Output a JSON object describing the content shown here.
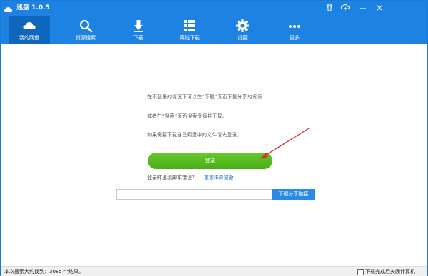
{
  "app": {
    "title": "迷盘 1.0.5",
    "accent_color": "#1d82e2",
    "logo_icon": "cloud-logo-icon"
  },
  "window_controls": [
    {
      "name": "skin-icon"
    },
    {
      "name": "upload-icon"
    },
    {
      "name": "minimize-icon"
    },
    {
      "name": "close-icon"
    }
  ],
  "toolbar": {
    "tabs": [
      {
        "label": "我的网盘",
        "icon": "cloud-icon",
        "active": true
      },
      {
        "label": "资源搜索",
        "icon": "search-icon",
        "active": false
      },
      {
        "label": "下载",
        "icon": "download-icon",
        "active": false
      },
      {
        "label": "离线下载",
        "icon": "list-icon",
        "active": false
      },
      {
        "label": "设置",
        "icon": "gear-icon",
        "active": false
      },
      {
        "label": "更多",
        "icon": "more-icon",
        "active": false
      }
    ]
  },
  "main": {
    "line1": "在不登录的情况下可以在“下载”页面下载分享的资源",
    "line2": "或者在“搜索”页面搜索资源并下载。",
    "line3": "如果需要下载自己网盘中的文件请先登录。",
    "login_button": "登录",
    "login_error_text": "登录时出现脚本错误？",
    "reset_browser_link": "重置IE浏览器",
    "share_link_value": "",
    "share_button": "下载分享链接",
    "login_button_color": "#55bb22",
    "arrow_color": "#d9322a"
  },
  "statusbar": {
    "search_result": "本次搜索大约找到：3085 个结果。",
    "shutdown_label": "下载完成后关闭计算机",
    "shutdown_checked": false
  }
}
